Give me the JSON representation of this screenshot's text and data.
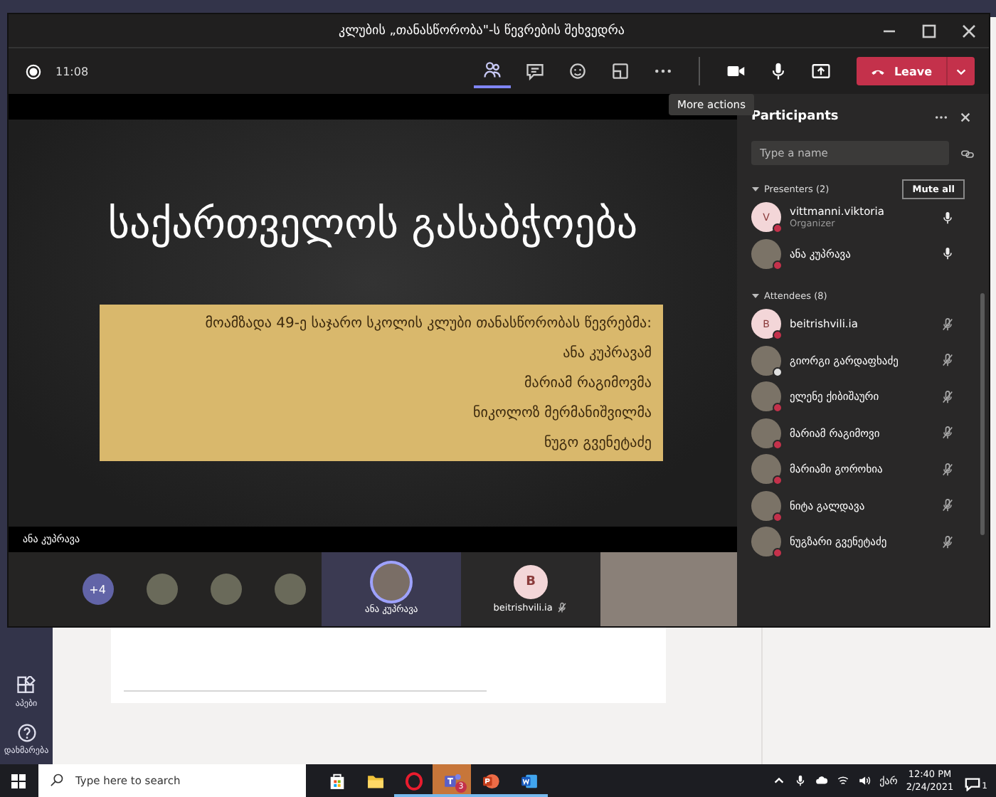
{
  "teams_rail": {
    "items": [
      {
        "kind": "apps",
        "label": "აპები"
      },
      {
        "kind": "help",
        "label": "დახმარება"
      }
    ]
  },
  "window": {
    "title": "კლუბის „თანასწორობა\"-ს წევრების შეხვედრა"
  },
  "toolbar": {
    "elapsed": "11:08",
    "tools": [
      {
        "kind": "participants",
        "selected": true
      },
      {
        "kind": "chat",
        "selected": false
      },
      {
        "kind": "reactions",
        "selected": false
      },
      {
        "kind": "rooms",
        "selected": false
      },
      {
        "kind": "more",
        "selected": false
      }
    ],
    "devices": [
      {
        "kind": "camera"
      },
      {
        "kind": "mic"
      },
      {
        "kind": "share"
      }
    ],
    "leave_label": "Leave",
    "tooltip": "More actions"
  },
  "stage": {
    "slide": {
      "title": "საქართველოს გასაბჭოება",
      "lines": [
        "მოამზადა 49-ე საჯარო სკოლის კლუბი თანასწორობას წევრებმა:",
        "ანა კუპრავამ",
        "მარიამ რაგიმოვმა",
        "ნიკოლოზ მერმანიშვილმა",
        "ნუგო გვენეტაძე"
      ]
    },
    "presenter_name": "ანა კუპრავა",
    "tiles": [
      {
        "kind": "overflow",
        "label": "+4"
      },
      {
        "kind": "avatar-photo"
      },
      {
        "kind": "avatar-photo"
      },
      {
        "kind": "avatar-photo"
      },
      {
        "kind": "person",
        "name": "ანა კუპრავა",
        "selected": true,
        "muted": false
      },
      {
        "kind": "person",
        "initial": "B",
        "name": "beitrishvili.ia",
        "selected": false,
        "muted": true
      },
      {
        "kind": "video"
      }
    ]
  },
  "participants": {
    "title": "Participants",
    "search": {
      "placeholder": "Type a name"
    },
    "sections": [
      {
        "label": "Presenters (2)",
        "action": "Mute all",
        "people": [
          {
            "name": "vittmanni.viktoria",
            "role": "Organizer",
            "initial": "V",
            "color": "#c4314b",
            "muted": false
          },
          {
            "name": "ანა კუპრავა",
            "color": "#c4314b",
            "muted": false
          }
        ]
      },
      {
        "label": "Attendees (8)",
        "people": [
          {
            "name": "beitrishvili.ia",
            "initial": "B",
            "color": "#c4314b",
            "muted": true
          },
          {
            "name": "გიორგი გარდაფხაძე",
            "color": "#e0e0e0",
            "muted": true
          },
          {
            "name": "ელენე ქიბიშაური",
            "color": "#c4314b",
            "muted": true
          },
          {
            "name": "მარიამ რაგიმოვი",
            "color": "#c4314b",
            "muted": true
          },
          {
            "name": "მარიამი გოროხია",
            "color": "#c4314b",
            "muted": true
          },
          {
            "name": "ნიტა გალდავა",
            "color": "#c4314b",
            "muted": true
          },
          {
            "name": "ნუგზარი გვენეტაძე",
            "color": "#c4314b",
            "muted": true
          }
        ]
      }
    ]
  },
  "taskbar": {
    "search": {
      "placeholder": "Type here to search"
    },
    "apps": [
      {
        "kind": "store",
        "running": false,
        "selected": false
      },
      {
        "kind": "explorer",
        "running": false,
        "selected": false
      },
      {
        "kind": "opera",
        "running": true,
        "selected": false
      },
      {
        "kind": "teams",
        "running": true,
        "selected": true,
        "badge": "3"
      },
      {
        "kind": "powerpoint",
        "running": true,
        "selected": false
      },
      {
        "kind": "word",
        "running": true,
        "selected": false
      }
    ],
    "language": "ქარ",
    "time": "12:40 PM",
    "date": "2/24/2021",
    "notifications": "1"
  }
}
